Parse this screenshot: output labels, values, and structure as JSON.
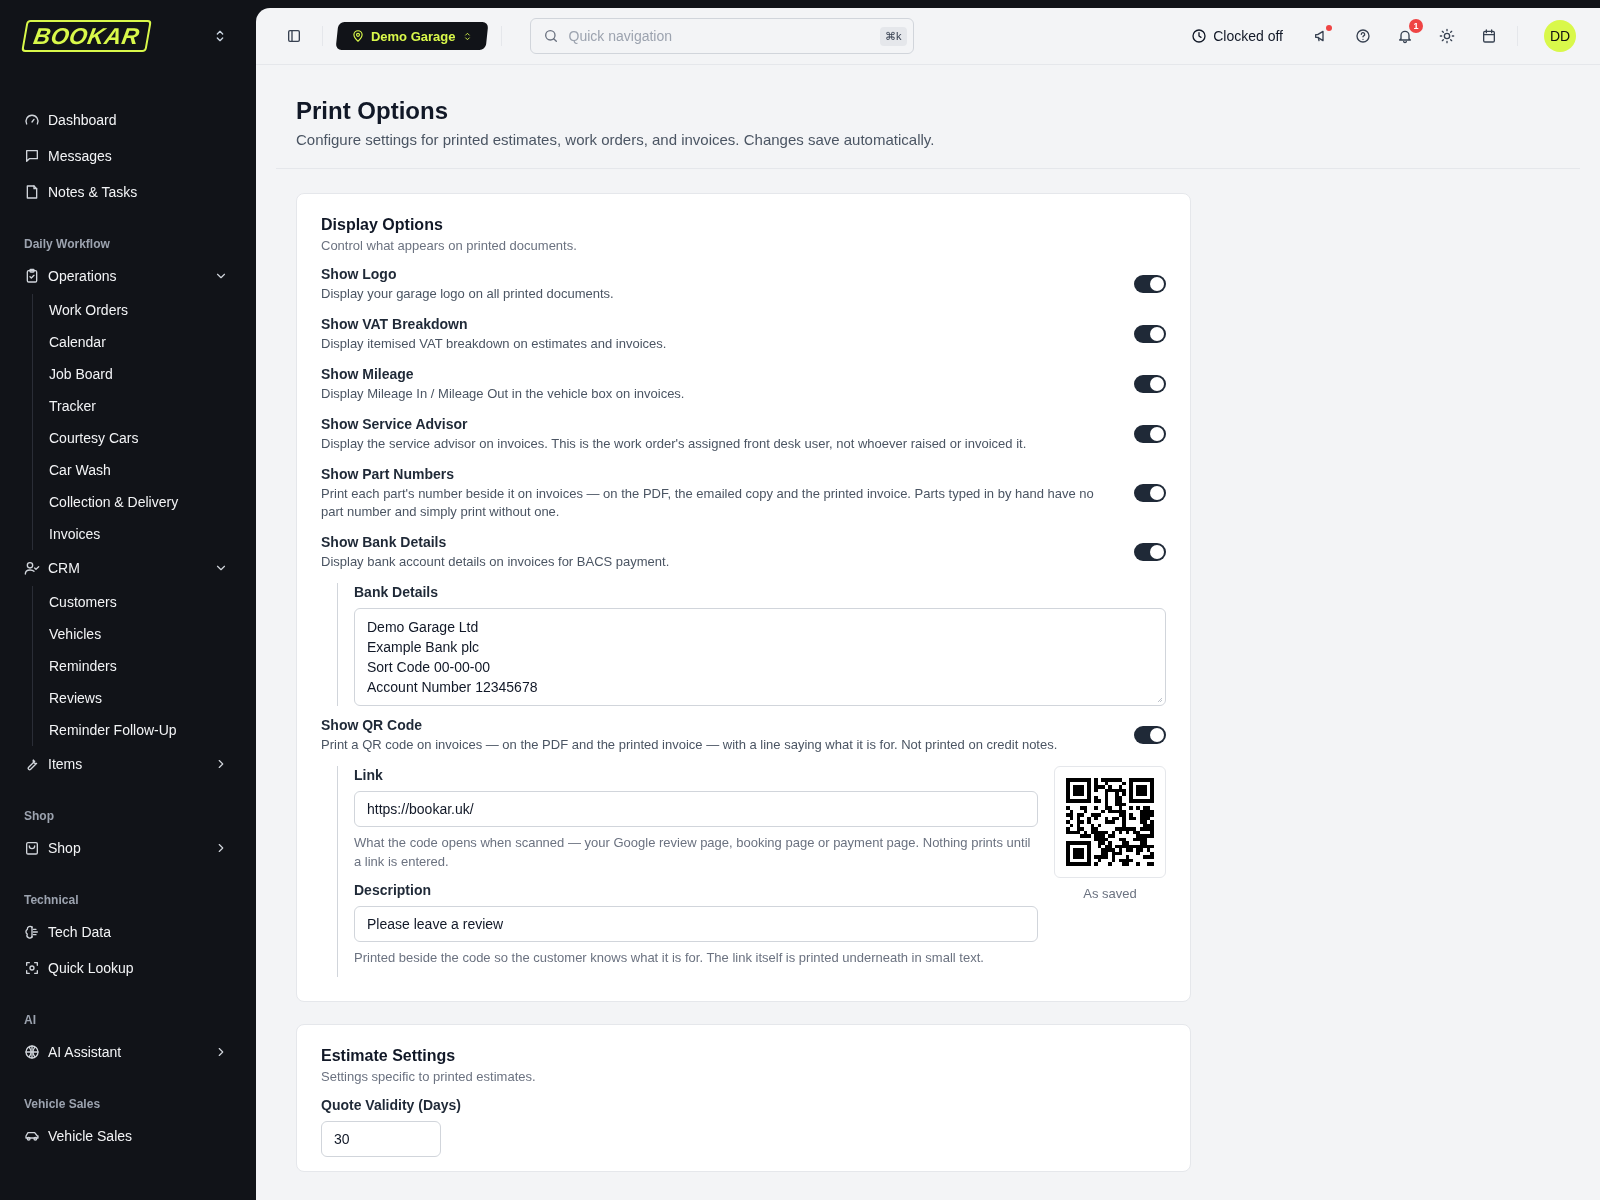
{
  "logo": {
    "text": "BOOKAR"
  },
  "sidebar": {
    "sections": [
      {
        "items": [
          {
            "label": "Dashboard"
          },
          {
            "label": "Messages"
          },
          {
            "label": "Notes & Tasks"
          }
        ]
      },
      {
        "label": "Daily Workflow",
        "items": [
          {
            "label": "Operations",
            "expanded": true,
            "children": [
              {
                "label": "Work Orders"
              },
              {
                "label": "Calendar"
              },
              {
                "label": "Job Board"
              },
              {
                "label": "Tracker"
              },
              {
                "label": "Courtesy Cars"
              },
              {
                "label": "Car Wash"
              },
              {
                "label": "Collection & Delivery"
              },
              {
                "label": "Invoices"
              }
            ]
          },
          {
            "label": "CRM",
            "expanded": true,
            "children": [
              {
                "label": "Customers"
              },
              {
                "label": "Vehicles"
              },
              {
                "label": "Reminders"
              },
              {
                "label": "Reviews"
              },
              {
                "label": "Reminder Follow-Up"
              }
            ]
          },
          {
            "label": "Items",
            "expanded": false
          }
        ]
      },
      {
        "label": "Shop",
        "items": [
          {
            "label": "Shop",
            "expanded": false
          }
        ]
      },
      {
        "label": "Technical",
        "items": [
          {
            "label": "Tech Data"
          },
          {
            "label": "Quick Lookup"
          }
        ]
      },
      {
        "label": "AI",
        "items": [
          {
            "label": "AI Assistant",
            "expanded": false
          }
        ]
      },
      {
        "label": "Vehicle Sales",
        "items": [
          {
            "label": "Vehicle Sales"
          }
        ]
      }
    ]
  },
  "topbar": {
    "location": "Demo Garage",
    "search": {
      "placeholder": "Quick navigation",
      "shortcut": "⌘k"
    },
    "clock_status": "Clocked off",
    "notification_count": "1",
    "avatar": "DD"
  },
  "page": {
    "title": "Print Options",
    "subtitle": "Configure settings for printed estimates, work orders, and invoices. Changes save automatically."
  },
  "display_options": {
    "title": "Display Options",
    "subtitle": "Control what appears on printed documents.",
    "toggles": [
      {
        "title": "Show Logo",
        "description": "Display your garage logo on all printed documents.",
        "on": true
      },
      {
        "title": "Show VAT Breakdown",
        "description": "Display itemised VAT breakdown on estimates and invoices.",
        "on": true
      },
      {
        "title": "Show Mileage",
        "description": "Display Mileage In / Mileage Out in the vehicle box on invoices.",
        "on": true
      },
      {
        "title": "Show Service Advisor",
        "description": "Display the service advisor on invoices. This is the work order's assigned front desk user, not whoever raised or invoiced it.",
        "on": true
      },
      {
        "title": "Show Part Numbers",
        "description": "Print each part's number beside it on invoices — on the PDF, the emailed copy and the printed invoice. Parts typed in by hand have no part number and simply print without one.",
        "on": true
      },
      {
        "title": "Show Bank Details",
        "description": "Display bank account details on invoices for BACS payment.",
        "on": true,
        "bank_details": {
          "label": "Bank Details",
          "value": "Demo Garage Ltd\nExample Bank plc\nSort Code 00-00-00\nAccount Number 12345678"
        }
      },
      {
        "title": "Show QR Code",
        "description": "Print a QR code on invoices — on the PDF and the printed invoice — with a line saying what it is for. Not printed on credit notes.",
        "on": true,
        "qr": {
          "link_label": "Link",
          "link": "https://bookar.uk/",
          "link_help": "What the code opens when scanned — your Google review page, booking page or payment page. Nothing prints until a link is entered.",
          "description_label": "Description",
          "description": "Please leave a review",
          "description_help": "Printed beside the code so the customer knows what it is for. The link itself is printed underneath in small text.",
          "preview_caption": "As saved"
        }
      }
    ]
  },
  "estimate_settings": {
    "title": "Estimate Settings",
    "subtitle": "Settings specific to printed estimates.",
    "fields": [
      {
        "label": "Quote Validity (Days)",
        "value": "30"
      }
    ]
  }
}
